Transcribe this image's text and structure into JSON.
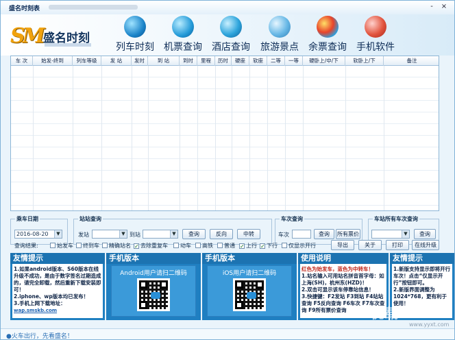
{
  "window": {
    "title": "盛名时刻表",
    "minimize": "-",
    "close": "×"
  },
  "logo": {
    "mark": "SM",
    "name": "盛名时刻"
  },
  "nav": [
    {
      "label": "列车时刻",
      "icon": "train-icon"
    },
    {
      "label": "机票查询",
      "icon": "plane-icon"
    },
    {
      "label": "酒店查询",
      "icon": "hotel-icon"
    },
    {
      "label": "旅游景点",
      "icon": "scenic-icon"
    },
    {
      "label": "余票查询",
      "icon": "ticket-icon"
    },
    {
      "label": "手机软件",
      "icon": "phone-icon"
    }
  ],
  "table": {
    "columns": [
      "车 次",
      "始发-终到",
      "列车等级",
      "发 站",
      "发时",
      "到 站",
      "到时",
      "里程",
      "历时",
      "硬座",
      "软座",
      "二等",
      "一等",
      "硬卧上/中/下",
      "软卧上/下",
      "备注"
    ]
  },
  "controls": {
    "date_legend": "乘车日期",
    "date_value": "2016-08-20",
    "station_legend": "站站查询",
    "from_label": "发站",
    "to_label": "到站",
    "query_btn": "查询",
    "reverse_btn": "反向",
    "transfer_btn": "中转",
    "train_legend": "车次查询",
    "train_label": "车次",
    "train_query_btn": "查询",
    "all_price_btn": "所有票价",
    "all_station_legend": "车站所有车次查询",
    "all_station_query_btn": "查询"
  },
  "filters": {
    "label": "查询结果:",
    "items": [
      {
        "label": "始发车",
        "checked": false
      },
      {
        "label": "终到车",
        "checked": false
      },
      {
        "label": "精确站名",
        "checked": false
      },
      {
        "label": "去除重复车",
        "checked": true
      },
      {
        "label": "动车",
        "checked": false
      },
      {
        "label": "高铁",
        "checked": false
      },
      {
        "label": "普通",
        "checked": false
      },
      {
        "label": "上行",
        "checked": true
      },
      {
        "label": "下行",
        "checked": true
      },
      {
        "label": "仅显示开行",
        "checked": false
      }
    ],
    "export_btn": "导出",
    "about_btn": "关于",
    "print_btn": "打印",
    "upgrade_btn": "在线升级"
  },
  "panels": {
    "notice_title": "友情提示",
    "notice_lines": [
      "1.如果android版本、S60版本在线升级不成功，是由于数字签名过期造成的，请完全卸载，然后重新下载安装即可！",
      "2.iphone、wp版本均已发布！",
      "3.手机上网下载地址："
    ],
    "notice_link": "wap.smskb.com",
    "android_title": "手机版本",
    "android_caption": "Android用户请扫二维码",
    "ios_title": "手机版本",
    "ios_caption": "iOS用户请扫二维码",
    "guide_title": "使用说明",
    "guide_lines": [
      "红色为始发车，蓝色为中转车！",
      "1.站名输入可用站名拼音首字母：如上海(SH)，杭州东(HZD)！",
      "2.双击可显示该车停靠站信息！",
      "3.快捷键：F2发站 F3到站 F4站站查询 F5反向查询 F6车次 F7车次查询 F9所有票价查询"
    ],
    "tip2_title": "友情提示",
    "tip2_lines": [
      "1.新版支持显示即将开行车次！点击“仅显示开行”按钮即可。",
      "2.新版界面调整为1024*768，更有利于使用！"
    ]
  },
  "status": {
    "text": "●火车出行，先看盛名！"
  },
  "watermark": {
    "text": "优载",
    "sub": "www.yyxt.com"
  }
}
